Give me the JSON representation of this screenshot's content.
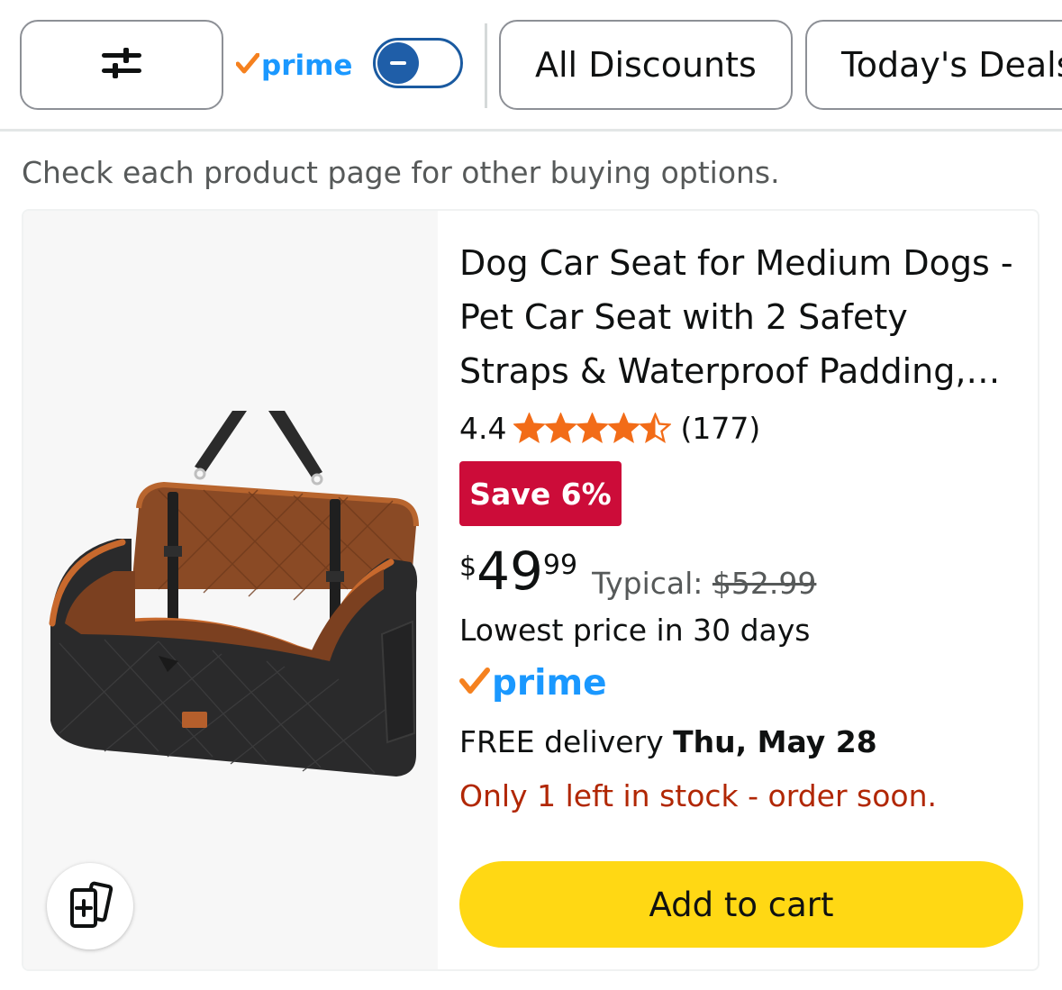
{
  "filters": {
    "filter_icon": "sliders-icon",
    "prime_label": "prime",
    "prime_toggle_on": false,
    "pills": [
      "All Discounts",
      "Today's Deals"
    ]
  },
  "notice": "Check each product page for other buying options.",
  "product": {
    "title": "Dog Car Seat for Medium Dogs - Pet Car Seat with 2 Safety Straps & Waterproof Padding,…",
    "rating": "4.4",
    "stars_value": 4.4,
    "review_count": "(177)",
    "save_badge": "Save 6%",
    "price": {
      "currency": "$",
      "whole": "49",
      "fraction": "99",
      "typical_label": "Typical:",
      "typical_price": "$52.99"
    },
    "lowest_price_note": "Lowest price in 30 days",
    "prime_label": "prime",
    "delivery_prefix": "FREE delivery",
    "delivery_date": "Thu, May 28",
    "stock_note": "Only 1 left in stock - order soon.",
    "add_to_cart": "Add to cart",
    "compare_icon": "compare-cards-icon"
  },
  "colors": {
    "prime_blue": "#1a98ff",
    "prime_check": "#f5811f",
    "star_orange": "#f26c18",
    "save_red": "#cc0c39",
    "stock_red": "#b12704",
    "cart_yellow": "#ffd814",
    "toggle_blue": "#1f5ea8"
  }
}
